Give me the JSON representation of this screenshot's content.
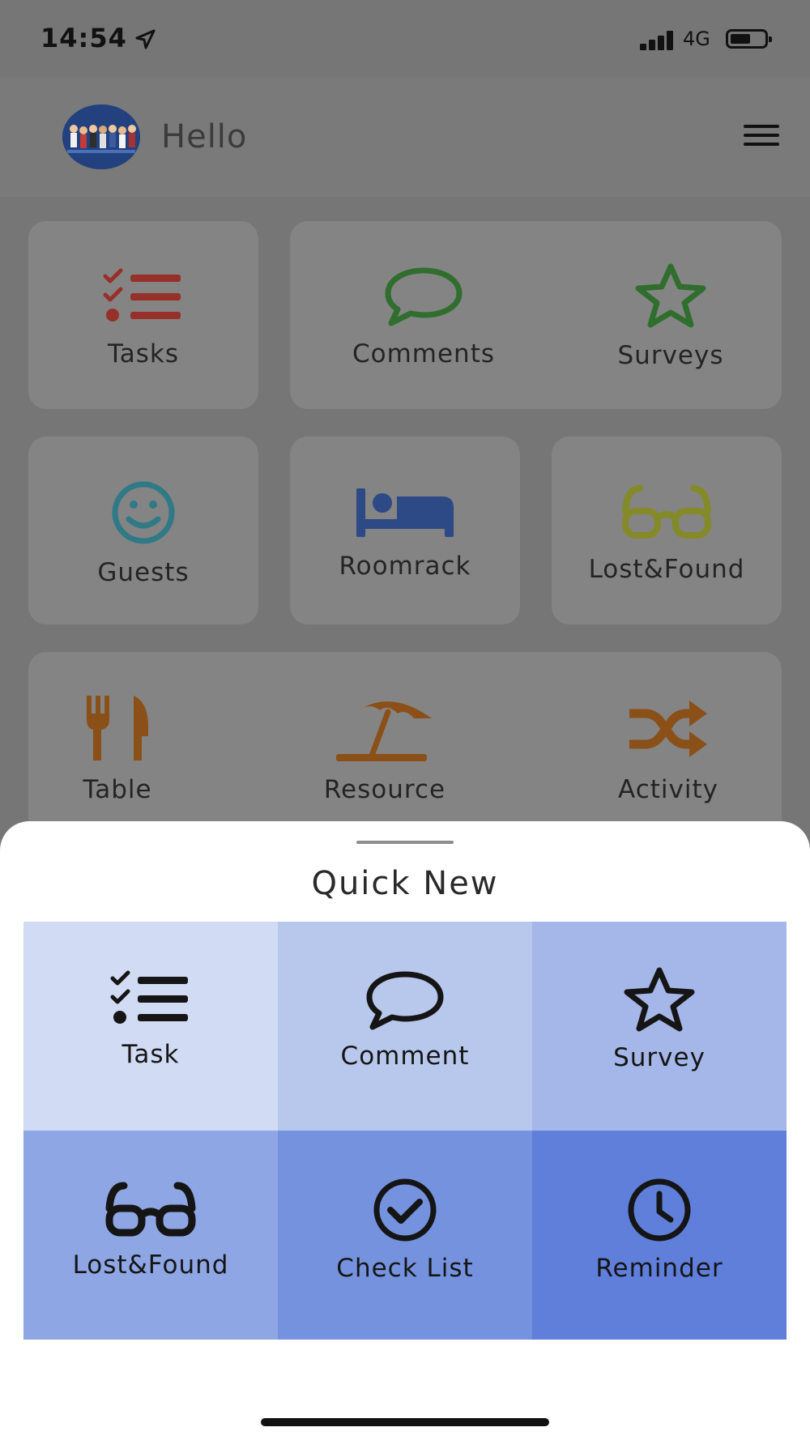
{
  "status_bar": {
    "time": "14:54",
    "network": "4G"
  },
  "header": {
    "greeting": "Hello"
  },
  "tiles": {
    "tasks": "Tasks",
    "comments": "Comments",
    "surveys": "Surveys",
    "guests": "Guests",
    "roomrack": "Roomrack",
    "lostfound": "Lost&Found",
    "table": "Table",
    "resource": "Resource",
    "activity": "Activity"
  },
  "tile_colors": {
    "tasks": "#963028",
    "comments": "#2f6e2d",
    "surveys": "#2f6e2d",
    "guests": "#2f7a86",
    "roomrack": "#2d4a86",
    "lostfound": "#848a28",
    "table": "#8a5018",
    "resource": "#8a5018",
    "activity": "#8a5018"
  },
  "quick_new": {
    "title": "Quick New",
    "items": [
      {
        "label": "Task",
        "icon": "task-list-icon",
        "color": "#d1dbf4"
      },
      {
        "label": "Comment",
        "icon": "comment-bubble-icon",
        "color": "#b8c8ed"
      },
      {
        "label": "Survey",
        "icon": "star-icon",
        "color": "#a4b7e8"
      },
      {
        "label": "Lost&Found",
        "icon": "glasses-icon",
        "color": "#8ea6e4"
      },
      {
        "label": "Check List",
        "icon": "check-circle-icon",
        "color": "#7592de"
      },
      {
        "label": "Reminder",
        "icon": "clock-icon",
        "color": "#5f7fda"
      }
    ]
  }
}
